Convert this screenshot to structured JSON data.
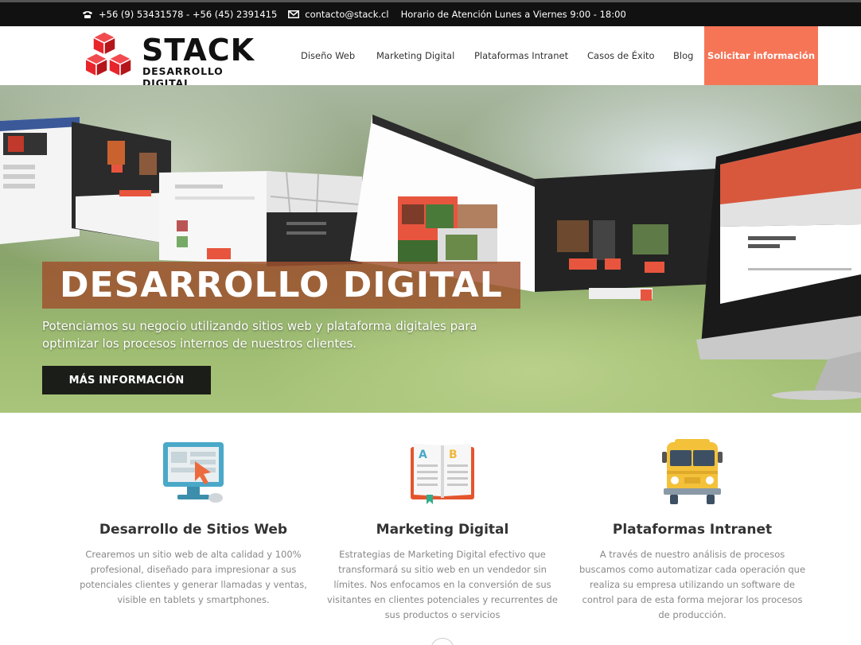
{
  "topbar": {
    "phone_icon": "phone-icon",
    "phone": "+56 (9) 53431578 - +56 (45) 2391415",
    "email_icon": "envelope-icon",
    "email": "contacto@stack.cl",
    "hours": "Horario de Atención Lunes a Viernes 9:00 - 18:00"
  },
  "logo": {
    "name": "STACK",
    "tagline": "DESARROLLO DIGITAL",
    "accent": "#e8252b"
  },
  "nav": {
    "items": [
      {
        "label": "Diseño Web"
      },
      {
        "label": "Marketing Digital"
      },
      {
        "label": "Plataformas Intranet"
      },
      {
        "label": "Casos de Éxito"
      },
      {
        "label": "Blog"
      }
    ],
    "cta": "Solicitar información",
    "cta_color": "#f67557"
  },
  "hero": {
    "title": "DESARROLLO DIGITAL",
    "subtitle": "Potenciamos su negocio utilizando sitios web y plataforma digitales para optimizar los procesos internos de nuestros clientes.",
    "button": "MÁS INFORMACIÓN"
  },
  "features": [
    {
      "icon": "computer-cursor-icon",
      "title": "Desarrollo de Sitios Web",
      "text": "Crearemos un sitio web de alta calidad y 100% profesional, diseñado para impresionar a sus potenciales clientes y generar llamadas y ventas, visible en tablets y smartphones."
    },
    {
      "icon": "open-book-icon",
      "title": "Marketing Digital",
      "text": "Estrategias de Marketing Digital efectivo que transformará su sitio web en un vendedor sin límites. Nos enfocamos en la conversión de sus visitantes en clientes potenciales y recurrentes de sus productos o servicios"
    },
    {
      "icon": "bus-icon",
      "title": "Plataformas Intranet",
      "text": "A través de nuestro análisis de procesos buscamos como automatizar cada operación que realiza su empresa utilizando un software de control para de esta forma mejorar los procesos de producción."
    }
  ]
}
